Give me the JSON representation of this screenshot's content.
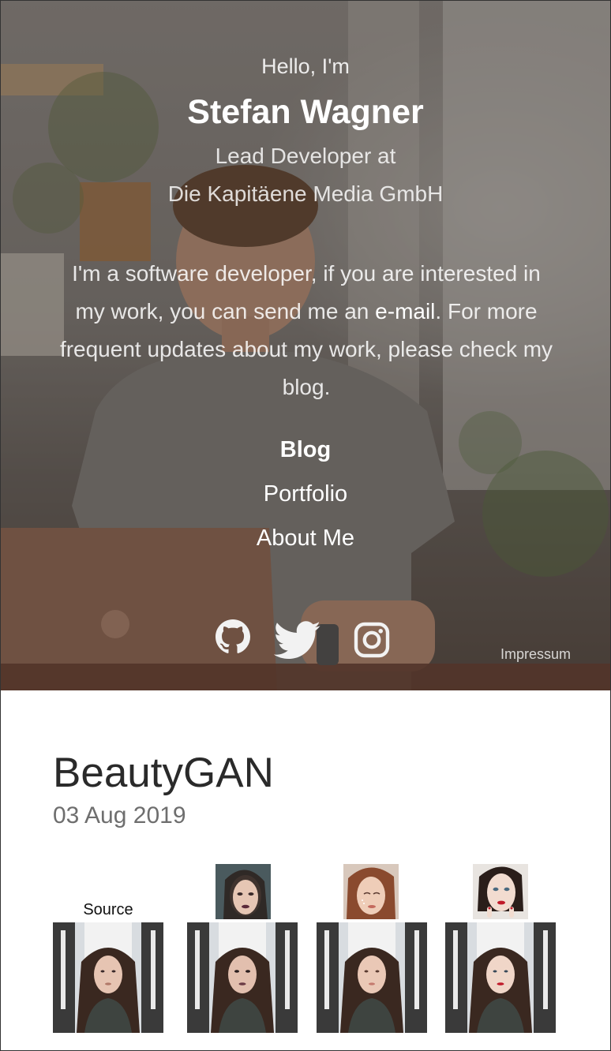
{
  "hero": {
    "greeting": "Hello, I'm",
    "name": "Stefan Wagner",
    "role_line1": "Lead Developer at",
    "role_line2": "Die Kapitäene Media GmbH",
    "bio_before": "I'm a software developer, if you are interested in my work, you can send me an ",
    "bio_link": "e-mail",
    "bio_after": ". For more frequent updates about my work, please check my blog."
  },
  "nav": {
    "items": [
      {
        "label": "Blog",
        "active": true
      },
      {
        "label": "Portfolio",
        "active": false
      },
      {
        "label": "About Me",
        "active": false
      }
    ]
  },
  "social": {
    "icons": [
      "github-icon",
      "twitter-icon",
      "instagram-icon"
    ]
  },
  "footer": {
    "impressum": "Impressum"
  },
  "post": {
    "title": "BeautyGAN",
    "date": "03 Aug 2019",
    "source_label": "Source"
  },
  "colors": {
    "overlay": "#28231f",
    "title_text": "#2a2a2a",
    "date_text": "#6e6e6e"
  }
}
